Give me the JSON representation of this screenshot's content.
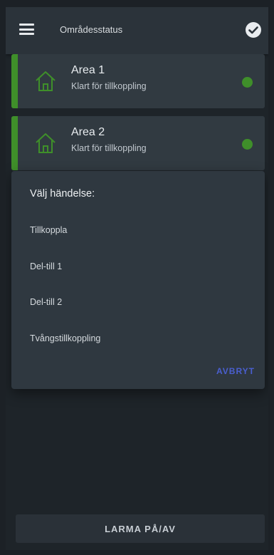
{
  "appbar": {
    "title": "Områdesstatus",
    "menu_icon": "menu-icon",
    "check_icon": "check-circle-icon"
  },
  "areas": [
    {
      "name": "Area 1",
      "status": "Klart för tillkoppling",
      "icon": "home-icon",
      "status_color": "#3f8f2a"
    },
    {
      "name": "Area 2",
      "status": "Klart för tillkoppling",
      "icon": "home-icon",
      "status_color": "#3f8f2a"
    }
  ],
  "dialog": {
    "title": "Välj händelse:",
    "options": [
      "Tillkoppla",
      "Del-till 1",
      "Del-till 2",
      "Tvångstillkoppling"
    ],
    "cancel_label": "AVBRYT"
  },
  "bottom_button": {
    "label": "LARMA PÅ/AV"
  },
  "colors": {
    "accent_green": "#3f8f2a",
    "cancel_blue": "#4a5fd0",
    "background": "#1e2429"
  }
}
